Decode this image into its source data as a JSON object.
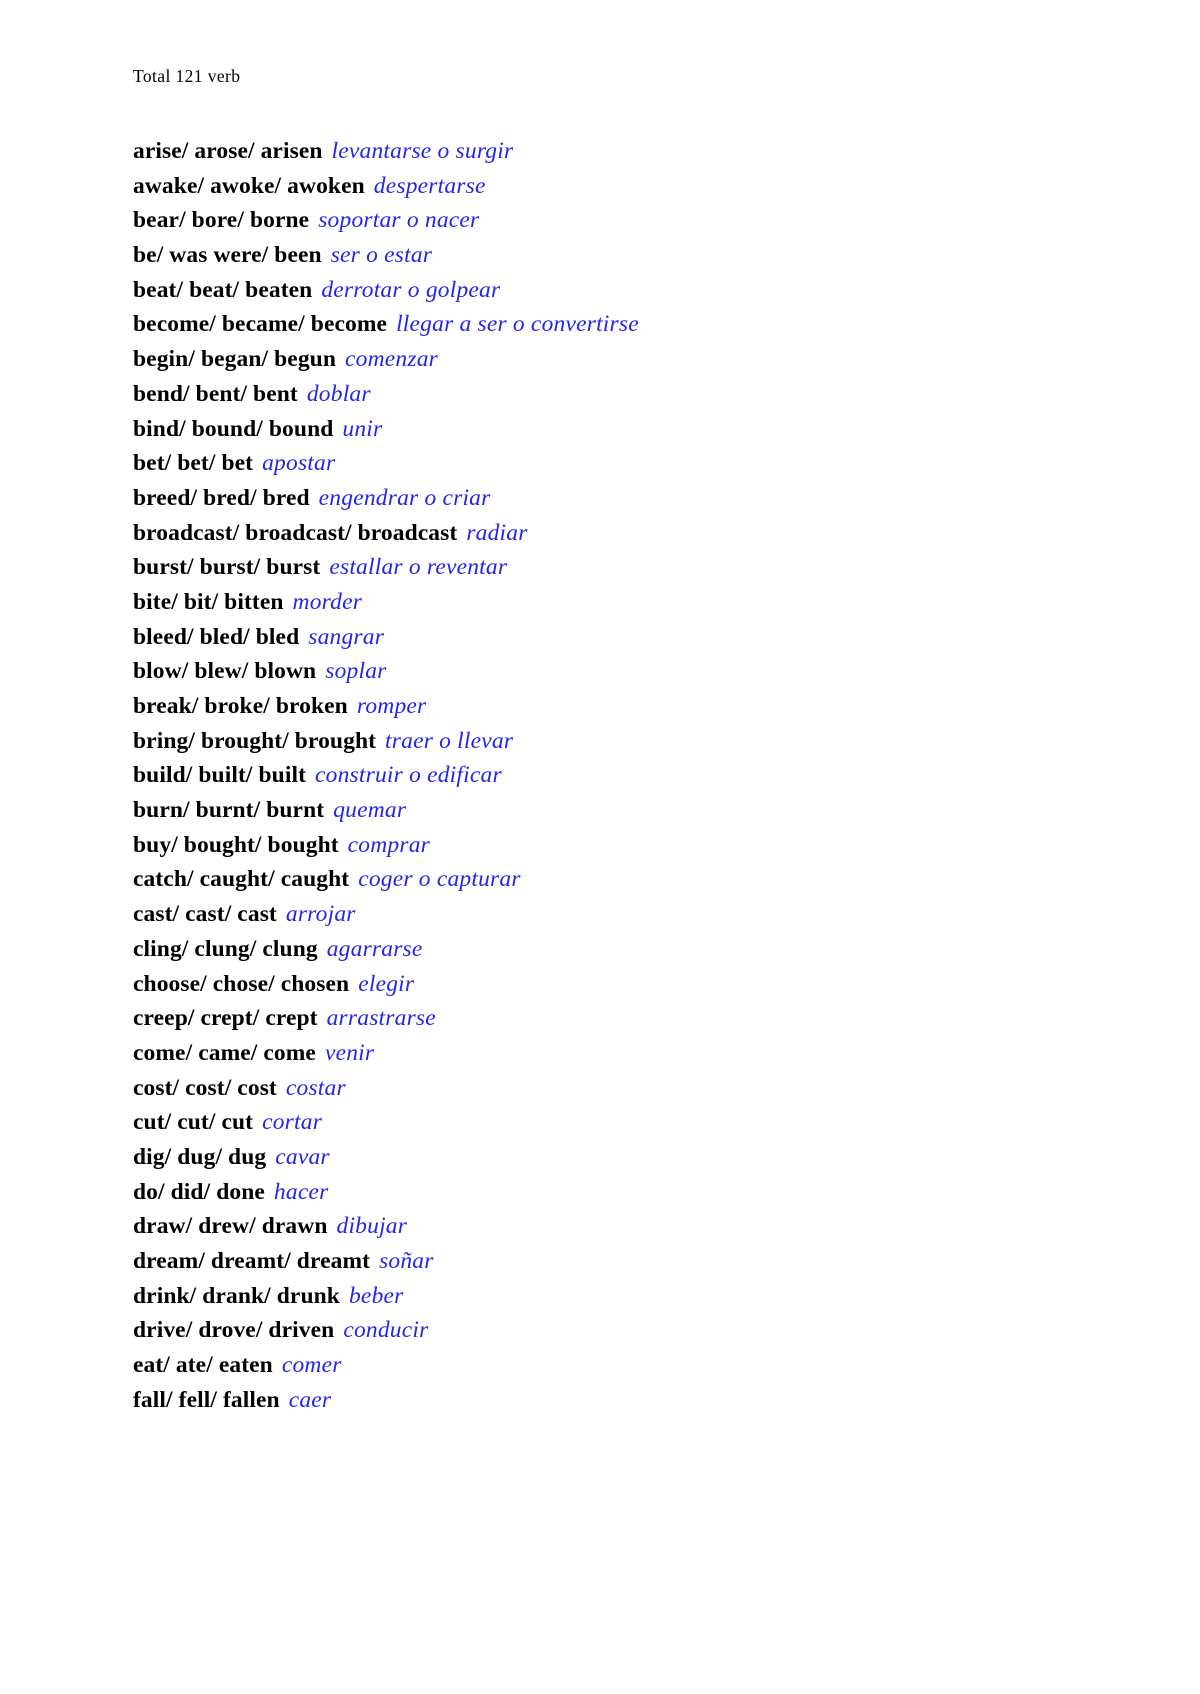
{
  "document": {
    "header": "Total 121 verb"
  },
  "colors": {
    "text": "#000000",
    "gloss": "#2424ea",
    "page_background": "#ffffff"
  },
  "verbs": [
    {
      "forms": "arise/ arose/ arisen",
      "gloss": "levantarse o surgir"
    },
    {
      "forms": "awake/ awoke/ awoken",
      "gloss": "despertarse"
    },
    {
      "forms": "bear/ bore/ borne",
      "gloss": "soportar o nacer"
    },
    {
      "forms": "be/ was were/ been",
      "gloss": "ser o estar"
    },
    {
      "forms": "beat/ beat/ beaten",
      "gloss": "derrotar o golpear"
    },
    {
      "forms": "become/ became/ become",
      "gloss": "llegar a ser o convertirse"
    },
    {
      "forms": "begin/ began/ begun",
      "gloss": "comenzar"
    },
    {
      "forms": "bend/ bent/ bent",
      "gloss": "doblar"
    },
    {
      "forms": "bind/ bound/ bound",
      "gloss": "unir"
    },
    {
      "forms": "bet/ bet/ bet",
      "gloss": "apostar"
    },
    {
      "forms": "breed/ bred/ bred",
      "gloss": "engendrar o criar"
    },
    {
      "forms": "broadcast/ broadcast/ broadcast",
      "gloss": "radiar"
    },
    {
      "forms": "burst/ burst/ burst",
      "gloss": "estallar o reventar"
    },
    {
      "forms": "bite/ bit/ bitten",
      "gloss": "morder"
    },
    {
      "forms": "bleed/ bled/ bled",
      "gloss": "sangrar"
    },
    {
      "forms": "blow/ blew/ blown",
      "gloss": "soplar"
    },
    {
      "forms": "break/ broke/ broken",
      "gloss": "romper"
    },
    {
      "forms": "bring/ brought/ brought",
      "gloss": "traer o llevar"
    },
    {
      "forms": "build/ built/ built",
      "gloss": "construir o edificar"
    },
    {
      "forms": "burn/ burnt/ burnt",
      "gloss": "quemar"
    },
    {
      "forms": "buy/ bought/ bought",
      "gloss": "comprar"
    },
    {
      "forms": "catch/ caught/ caught",
      "gloss": "coger o capturar"
    },
    {
      "forms": "cast/ cast/ cast",
      "gloss": "arrojar"
    },
    {
      "forms": "cling/ clung/ clung",
      "gloss": "agarrarse"
    },
    {
      "forms": "choose/ chose/ chosen",
      "gloss": "elegir"
    },
    {
      "forms": "creep/ crept/ crept",
      "gloss": "arrastrarse"
    },
    {
      "forms": "come/ came/ come",
      "gloss": "venir"
    },
    {
      "forms": "cost/ cost/ cost",
      "gloss": "costar"
    },
    {
      "forms": "cut/ cut/ cut",
      "gloss": "cortar"
    },
    {
      "forms": "dig/ dug/ dug",
      "gloss": "cavar"
    },
    {
      "forms": "do/ did/ done",
      "gloss": "hacer"
    },
    {
      "forms": "draw/ drew/ drawn",
      "gloss": "dibujar"
    },
    {
      "forms": "dream/ dreamt/ dreamt",
      "gloss": "soñar"
    },
    {
      "forms": "drink/ drank/ drunk",
      "gloss": "beber"
    },
    {
      "forms": "drive/ drove/ driven",
      "gloss": "conducir"
    },
    {
      "forms": "eat/ ate/ eaten",
      "gloss": "comer"
    },
    {
      "forms": "fall/ fell/ fallen",
      "gloss": "caer"
    }
  ]
}
